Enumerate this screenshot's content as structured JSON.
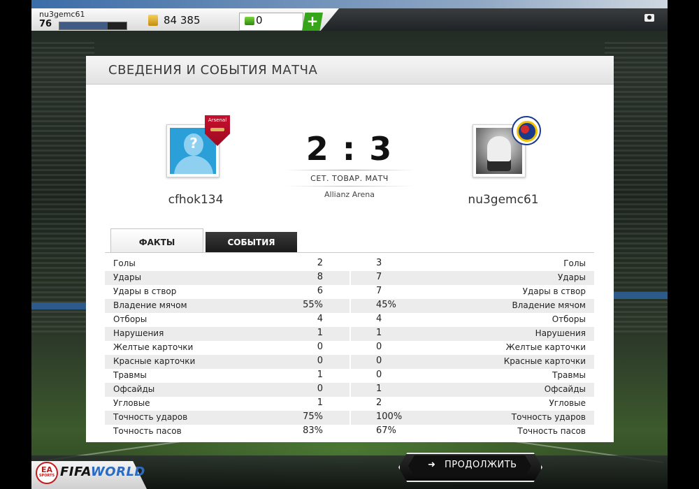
{
  "topbar": {
    "username": "nu3gemc61",
    "level": "76",
    "xp_fraction": 0.72,
    "coins": "84 385",
    "points": "0",
    "plus_label": "+"
  },
  "panel": {
    "title": "СВЕДЕНИЯ И СОБЫТИЯ МАТЧА"
  },
  "match": {
    "home_name": "cfhok134",
    "away_name": "nu3gemc61",
    "score": "2 : 3",
    "match_type": "СЕТ. ТОВАР. МАТЧ",
    "venue": "Allianz Arena",
    "home_crest_text": "Arsenal"
  },
  "tabs": {
    "facts": "ФАКТЫ",
    "events": "СОБЫТИЯ"
  },
  "stats": [
    {
      "label": "Голы",
      "home": "2",
      "away": "3"
    },
    {
      "label": "Удары",
      "home": "8",
      "away": "7"
    },
    {
      "label": "Удары в створ",
      "home": "6",
      "away": "7"
    },
    {
      "label": "Владение мячом",
      "home": "55%",
      "away": "45%"
    },
    {
      "label": "Отборы",
      "home": "4",
      "away": "4"
    },
    {
      "label": "Нарушения",
      "home": "1",
      "away": "1"
    },
    {
      "label": "Желтые карточки",
      "home": "0",
      "away": "0"
    },
    {
      "label": "Красные карточки",
      "home": "0",
      "away": "0"
    },
    {
      "label": "Травмы",
      "home": "1",
      "away": "0"
    },
    {
      "label": "Офсайды",
      "home": "0",
      "away": "1"
    },
    {
      "label": "Угловые",
      "home": "1",
      "away": "2"
    },
    {
      "label": "Точность ударов",
      "home": "75%",
      "away": "100%"
    },
    {
      "label": "Точность пасов",
      "home": "83%",
      "away": "67%"
    }
  ],
  "footer": {
    "brand_fifa": "FIFA",
    "brand_world": "WORLD",
    "ea_label": "EA",
    "ea_sub": "SPORTS",
    "continue_label": "ПРОДОЛЖИТЬ",
    "continue_icon": "arrow-right-icon"
  },
  "colors": {
    "plus_green": "#36a51a",
    "xp_fill": "#3f5b86",
    "home_avatar_bg": "#2a9fd8"
  }
}
